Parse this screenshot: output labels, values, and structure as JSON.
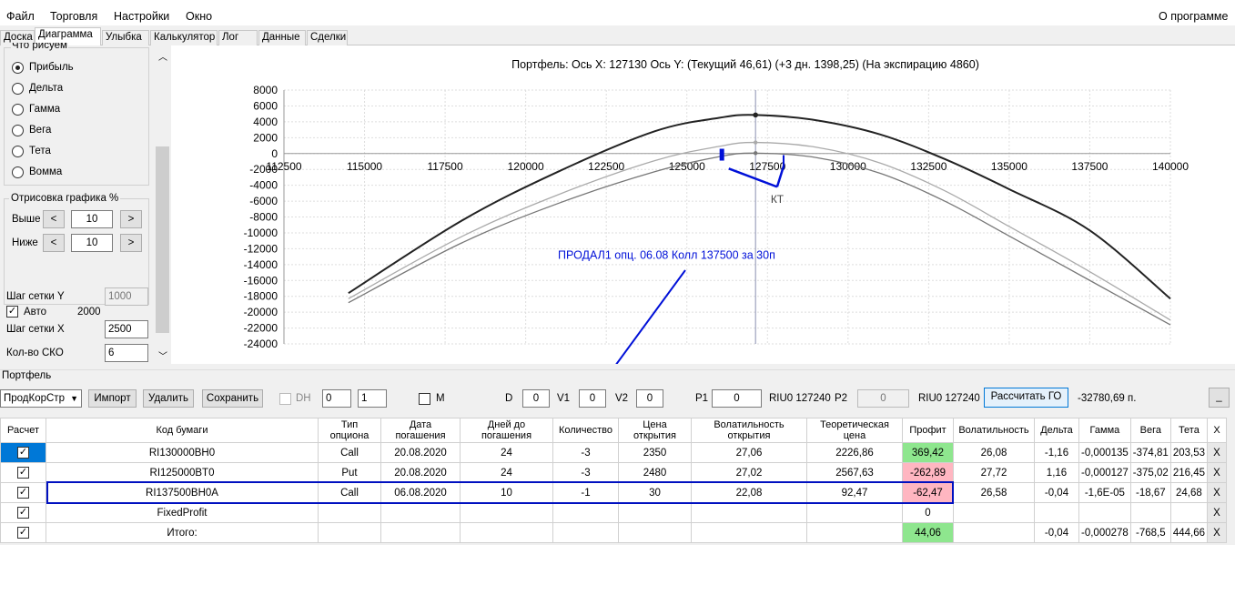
{
  "menu": {
    "file": "Файл",
    "trade": "Торговля",
    "settings": "Настройки",
    "window": "Окно",
    "about": "О программе"
  },
  "tabs": [
    "Доска",
    "Диаграмма",
    "Улыбка",
    "Калькулятор",
    "Лог",
    "Данные",
    "Сделки"
  ],
  "left": {
    "group_title": "Что рисуем",
    "radios": [
      {
        "label": "Прибыль",
        "checked": true
      },
      {
        "label": "Дельта"
      },
      {
        "label": "Гамма"
      },
      {
        "label": "Вега"
      },
      {
        "label": "Тета"
      },
      {
        "label": "Вомма"
      }
    ],
    "draw_title": "Отрисовка графика %",
    "above_label": "Выше",
    "above_value": "10",
    "below_label": "Ниже",
    "below_value": "10",
    "prev": "<",
    "next": ">",
    "grid_y_label": "Шаг сетки Y",
    "grid_y_value": "1000",
    "auto_label": "Авто",
    "auto_value": "2000",
    "grid_x_label": "Шаг сетки X",
    "grid_x_value": "2500",
    "sko_label": "Кол-во СКО",
    "sko_value": "6"
  },
  "chart_data": {
    "type": "line",
    "title": "Портфель: Ось X: 127130 Ось Y:  (Текущий 46,61)  (+3 дн. 1398,25)  (На экспирацию 4860)",
    "xlim": [
      112500,
      140000
    ],
    "ylim": [
      -24000,
      8000
    ],
    "xticks": [
      112500,
      115000,
      117500,
      120000,
      122500,
      125000,
      127500,
      130000,
      132500,
      135000,
      137500,
      140000
    ],
    "xtick_labels": [
      "112500",
      "115000",
      "117500",
      "120000",
      "122500",
      "125000",
      "127500",
      "130000",
      "132500",
      "135000",
      "137500",
      "140000"
    ],
    "yticks": [
      8000,
      6000,
      4000,
      2000,
      0,
      -2000,
      -4000,
      -6000,
      -8000,
      -10000,
      -12000,
      -14000,
      -16000,
      -18000,
      -20000,
      -22000,
      -24000
    ],
    "ytick_labels": [
      "8000",
      "6000",
      "4000",
      "2000",
      "0",
      "-2000",
      "-4000",
      "-6000",
      "-8000",
      "-10000",
      "-12000",
      "-14000",
      "-16000",
      "-18000",
      "-20000",
      "-22000",
      "-24000"
    ],
    "cursor_x": 127130,
    "series": [
      {
        "color": "#222222",
        "x": [
          114500,
          118000,
          121000,
          124000,
          126000,
          127130,
          129000,
          131000,
          133000,
          135000,
          137500,
          140000
        ],
        "y": [
          -17600,
          -8500,
          -2300,
          2800,
          4500,
          4860,
          4200,
          2400,
          -700,
          -4500,
          -9700,
          -18300
        ]
      },
      {
        "color": "#aaaaaa",
        "x": [
          114500,
          118000,
          121000,
          124000,
          126000,
          127130,
          129000,
          131000,
          133000,
          135000,
          137500,
          140000
        ],
        "y": [
          -18300,
          -10500,
          -5200,
          -900,
          900,
          1398,
          800,
          -1200,
          -4700,
          -9200,
          -14900,
          -21000
        ]
      },
      {
        "color": "#777777",
        "x": [
          114500,
          118000,
          121000,
          124000,
          126000,
          127130,
          129000,
          131000,
          133000,
          135000,
          137500,
          140000
        ],
        "y": [
          -18800,
          -11300,
          -6300,
          -2300,
          -400,
          47,
          -500,
          -2500,
          -6000,
          -10400,
          -16000,
          -21600
        ]
      }
    ],
    "annotation_text": "ПРОДАЛ1 опц. 06.08 Колл 137500 за 30п",
    "kt_text": "КТ"
  },
  "portfolio": {
    "title": "Портфель",
    "combo": "ПродКорСтр",
    "import": "Импорт",
    "delete": "Удалить",
    "save": "Сохранить",
    "dh_label": "DH",
    "spin1": "0",
    "spin2": "1",
    "m_label": "M",
    "d_label": "D",
    "d_value": "0",
    "v1_label": "V1",
    "v1_value": "0",
    "v2_label": "V2",
    "v2_value": "0",
    "p1_label": "P1",
    "p1_value": "0",
    "riu1": "RIU0 127240",
    "p2_label": "P2",
    "p2_value": "0",
    "riu2": "RIU0 127240",
    "calc": "Рассчитать ГО",
    "go_value": "-32780,69 п.",
    "min_btn": "_"
  },
  "table": {
    "headers": [
      "Расчет",
      "Код бумаги",
      "Тип опциона",
      "Дата погашения",
      "Дней до погашения",
      "Количество",
      "Цена открытия",
      "Волатильность открытия",
      "Теоретическая цена",
      "Профит",
      "Волатильность",
      "Дельта",
      "Гамма",
      "Вега",
      "Тета",
      "X"
    ],
    "rows": [
      [
        "RI130000BH0",
        "Call",
        "20.08.2020",
        "24",
        "-3",
        "2350",
        "27,06",
        "2226,86",
        "369,42",
        "26,08",
        "-1,16",
        "-0,000135",
        "-374,81",
        "203,53",
        "X"
      ],
      [
        "RI125000BT0",
        "Put",
        "20.08.2020",
        "24",
        "-3",
        "2480",
        "27,02",
        "2567,63",
        "-262,89",
        "27,72",
        "1,16",
        "-0,000127",
        "-375,02",
        "216,45",
        "X"
      ],
      [
        "RI137500BH0A",
        "Call",
        "06.08.2020",
        "10",
        "-1",
        "30",
        "22,08",
        "92,47",
        "-62,47",
        "26,58",
        "-0,04",
        "-1,6E-05",
        "-18,67",
        "24,68",
        "X"
      ],
      [
        "FixedProfit",
        "",
        "",
        "",
        "",
        "",
        "",
        "",
        "0",
        "",
        "",
        "",
        "",
        "",
        "X"
      ],
      [
        "Итого:",
        "",
        "",
        "",
        "",
        "",
        "",
        "",
        "44,06",
        "",
        "-0,04",
        "-0,000278",
        "-768,5",
        "444,66",
        "X"
      ]
    ]
  }
}
